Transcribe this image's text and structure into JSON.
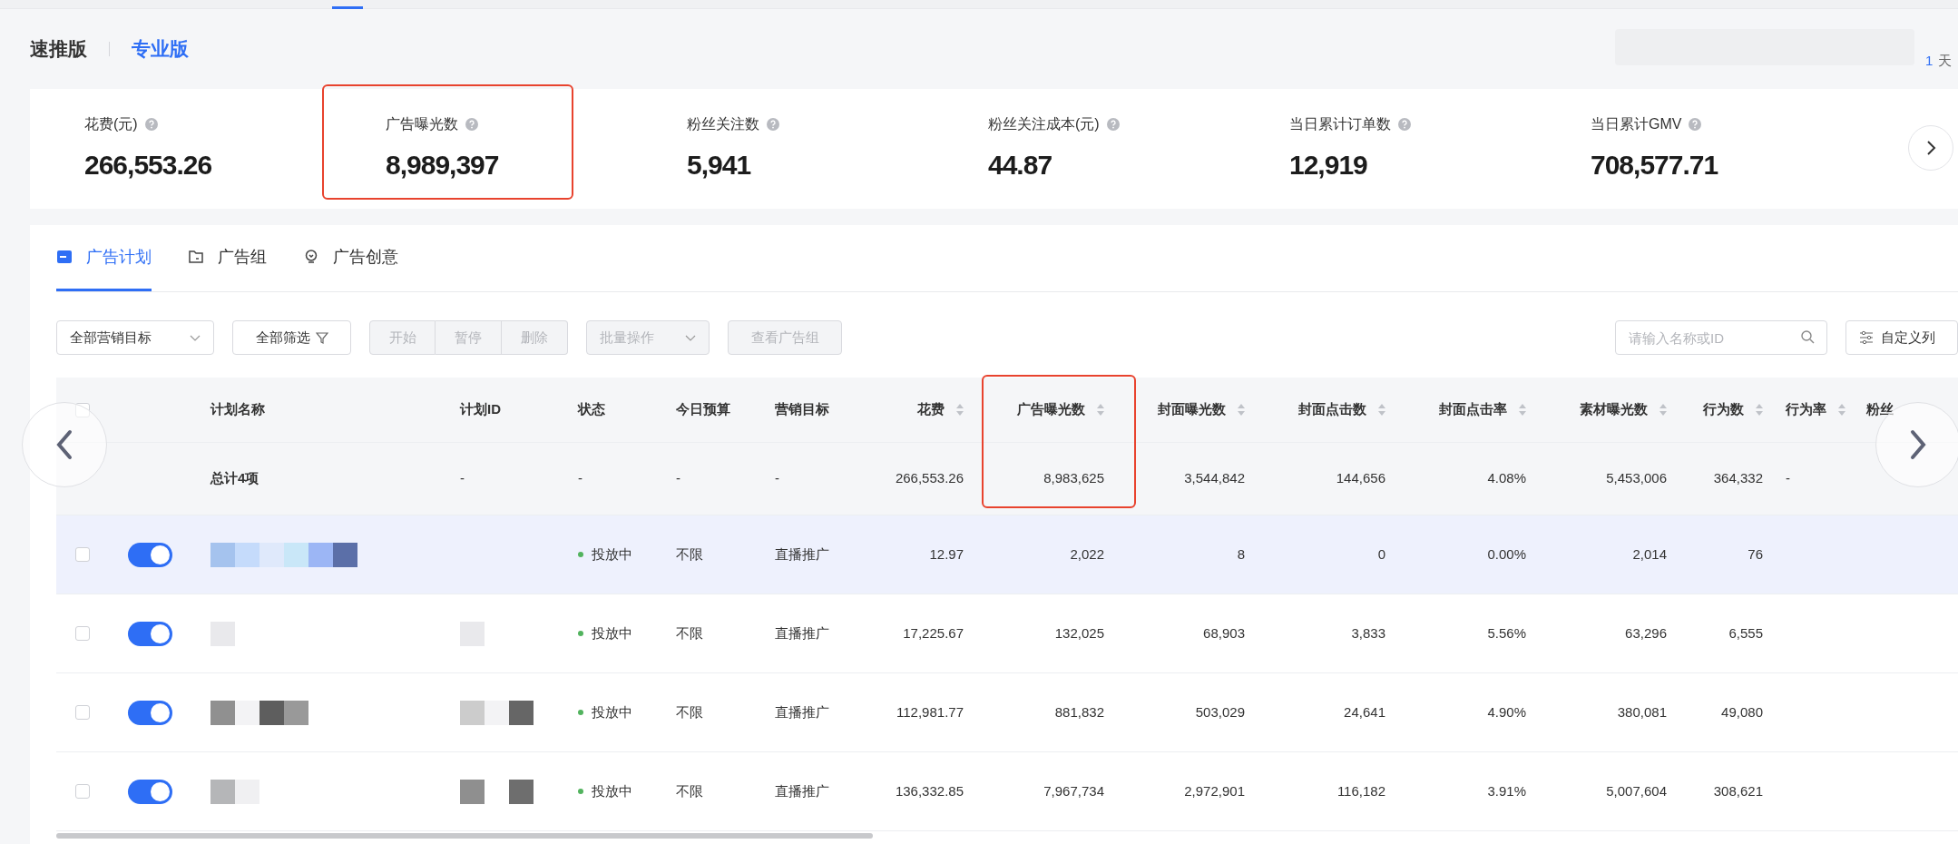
{
  "versions": [
    {
      "label": "速推版",
      "selected": false
    },
    {
      "label": "专业版",
      "selected": true
    }
  ],
  "period": {
    "value": "1",
    "unit": "天"
  },
  "metrics": [
    {
      "label": "花费(元)",
      "value": "266,553.26",
      "annotated": false,
      "faded": false
    },
    {
      "label": "广告曝光数",
      "value": "8,989,397",
      "annotated": true,
      "faded": false
    },
    {
      "label": "粉丝关注数",
      "value": "5,941",
      "annotated": false,
      "faded": false
    },
    {
      "label": "粉丝关注成本(元)",
      "value": "44.87",
      "annotated": false,
      "faded": false
    },
    {
      "label": "当日累计订单数",
      "value": "12,919",
      "annotated": false,
      "faded": false
    },
    {
      "label": "当日累计GMV",
      "value": "708,577.71",
      "annotated": false,
      "faded": false
    }
  ],
  "tabs": [
    {
      "label": "广告计划",
      "kind": "plan",
      "selected": true
    },
    {
      "label": "广告组",
      "kind": "group",
      "selected": false
    },
    {
      "label": "广告创意",
      "kind": "creative",
      "selected": false
    }
  ],
  "toolbar": {
    "goal_filter": "全部营销目标",
    "filter": "全部筛选",
    "actions": [
      {
        "label": "开始",
        "disabled": true
      },
      {
        "label": "暂停",
        "disabled": true
      },
      {
        "label": "删除",
        "disabled": true
      }
    ],
    "batch": {
      "label": "批量操作",
      "disabled": true
    },
    "view_groups": {
      "label": "查看广告组",
      "disabled": true
    },
    "search": {
      "placeholder": "请输入名称或ID"
    },
    "columns_button": "自定义列"
  },
  "table": {
    "select_all": {
      "checked": false
    },
    "columns": [
      {
        "label": "计划名称",
        "sortable": false,
        "annotated": false
      },
      {
        "label": "计划ID",
        "sortable": false,
        "annotated": false
      },
      {
        "label": "状态",
        "sortable": false,
        "annotated": false
      },
      {
        "label": "今日预算",
        "sortable": false,
        "annotated": false
      },
      {
        "label": "营销目标",
        "sortable": false,
        "annotated": false
      },
      {
        "label": "花费",
        "sortable": true,
        "annotated": false
      },
      {
        "label": "广告曝光数",
        "sortable": true,
        "annotated": true
      },
      {
        "label": "封面曝光数",
        "sortable": true,
        "annotated": false
      },
      {
        "label": "封面点击数",
        "sortable": true,
        "annotated": false
      },
      {
        "label": "封面点击率",
        "sortable": true,
        "annotated": false
      },
      {
        "label": "素材曝光数",
        "sortable": true,
        "annotated": false
      },
      {
        "label": "行为数",
        "sortable": true,
        "annotated": false
      },
      {
        "label": "行为率",
        "sortable": true,
        "annotated": false
      },
      {
        "label": "粉丝",
        "sortable": false,
        "annotated": false
      }
    ],
    "total_row": {
      "label": "总计4项",
      "cells": [
        "-",
        "-",
        "-",
        "-",
        "266,553.26",
        "8,983,625",
        "3,544,842",
        "144,656",
        "4.08%",
        "5,453,006",
        "364,332",
        "-"
      ]
    },
    "rows": [
      {
        "checked": false,
        "on": true,
        "highlighted": true,
        "status": "投放中",
        "budget": "不限",
        "goal": "直播推广",
        "metrics": [
          "12.97",
          "2,022",
          "8",
          "0",
          "0.00%",
          "2,014",
          "76"
        ]
      },
      {
        "checked": false,
        "on": true,
        "highlighted": false,
        "status": "投放中",
        "budget": "不限",
        "goal": "直播推广",
        "metrics": [
          "17,225.67",
          "132,025",
          "68,903",
          "3,833",
          "5.56%",
          "63,296",
          "6,555"
        ]
      },
      {
        "checked": false,
        "on": true,
        "highlighted": false,
        "status": "投放中",
        "budget": "不限",
        "goal": "直播推广",
        "metrics": [
          "112,981.77",
          "881,832",
          "503,029",
          "24,641",
          "4.90%",
          "380,081",
          "49,080"
        ]
      },
      {
        "checked": false,
        "on": true,
        "highlighted": false,
        "status": "投放中",
        "budget": "不限",
        "goal": "直播推广",
        "metrics": [
          "136,332.85",
          "7,967,734",
          "2,972,901",
          "116,182",
          "3.91%",
          "5,007,604",
          "308,621"
        ]
      }
    ]
  }
}
